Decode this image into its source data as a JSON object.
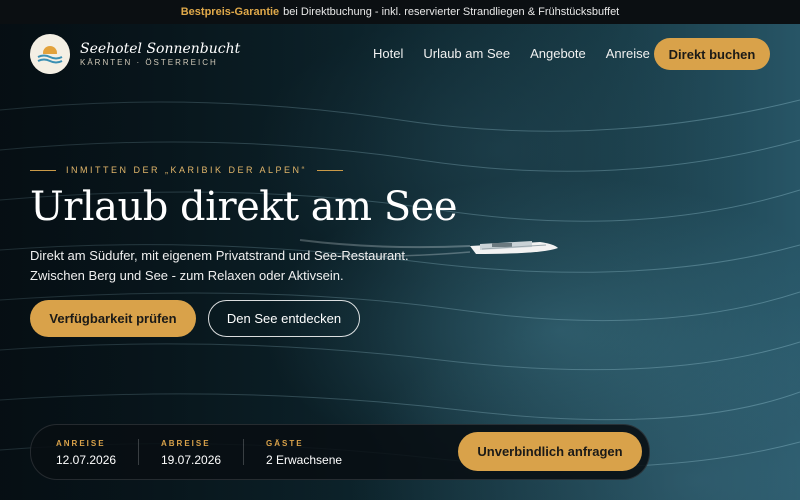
{
  "topbar": {
    "highlight": "Bestpreis-Garantie",
    "text": "bei Direktbuchung - inkl. reservierter Strandliegen & Frühstücksbuffet"
  },
  "brand": {
    "name": "Seehotel Sonnenbucht",
    "tagline": "KÄRNTEN · ÖSTERREICH"
  },
  "nav": {
    "items": [
      "Hotel",
      "Urlaub am See",
      "Angebote",
      "Anreise"
    ],
    "book_label": "Direkt buchen"
  },
  "hero": {
    "eyebrow": "INMITTEN DER „KARIBIK DER ALPEN“",
    "title": "Urlaub direkt am See",
    "lead_line1": "Direkt am Südufer, mit eigenem Privatstrand und See-Restaurant.",
    "lead_line2": "Zwischen Berg und See - zum Relaxen oder Aktivsein.",
    "primary_cta": "Verfügbarkeit prüfen",
    "secondary_cta": "Den See entdecken"
  },
  "booking": {
    "arrival_label": "ANREISE",
    "arrival_value": "12.07.2026",
    "departure_label": "ABREISE",
    "departure_value": "19.07.2026",
    "guests_label": "GÄSTE",
    "guests_value": "2 Erwachsene",
    "submit_label": "Unverbindlich anfragen"
  },
  "colors": {
    "accent": "#d9a24a",
    "topbar_bg": "#0b0f12",
    "water": "#1a3f4b"
  },
  "icons": {
    "logo": "sun-over-waves-icon",
    "boat": "sailboat-image"
  }
}
